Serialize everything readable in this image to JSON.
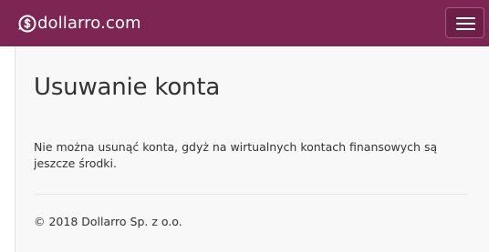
{
  "navbar": {
    "brand_name": "dollarro.com",
    "brand_icon": "dollar-circle-icon",
    "menu_icon": "hamburger-menu-icon",
    "background_color": "#7d2553"
  },
  "main": {
    "title": "Usuwanie konta",
    "message": "Nie można usunąć konta, gdyż na wirtualnych kontach finansowych są jeszcze środki."
  },
  "footer": {
    "copyright": "© 2018 Dollarro Sp. z o.o."
  }
}
